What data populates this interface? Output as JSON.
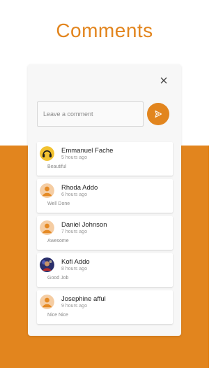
{
  "page": {
    "title": "Comments"
  },
  "colors": {
    "accent": "#e2851e"
  },
  "composer": {
    "placeholder": "Leave a comment",
    "close_icon": "close-icon",
    "send_icon": "send-icon"
  },
  "comments": [
    {
      "name": "Emmanuel Fache",
      "time": "5 hours ago",
      "text": "Beautiful",
      "avatar": "headphones-avatar"
    },
    {
      "name": "Rhoda Addo",
      "time": "6 hours ago",
      "text": "Well Done",
      "avatar": "default-user-avatar"
    },
    {
      "name": "Daniel Johnson",
      "time": "7 hours ago",
      "text": "Awesome",
      "avatar": "default-user-avatar"
    },
    {
      "name": "Kofi Addo",
      "time": "8 hours ago",
      "text": "Good Job",
      "avatar": "photo-avatar"
    },
    {
      "name": "Josephine afful",
      "time": "9 hours ago",
      "text": "Nice Nice",
      "avatar": "default-user-avatar"
    }
  ]
}
